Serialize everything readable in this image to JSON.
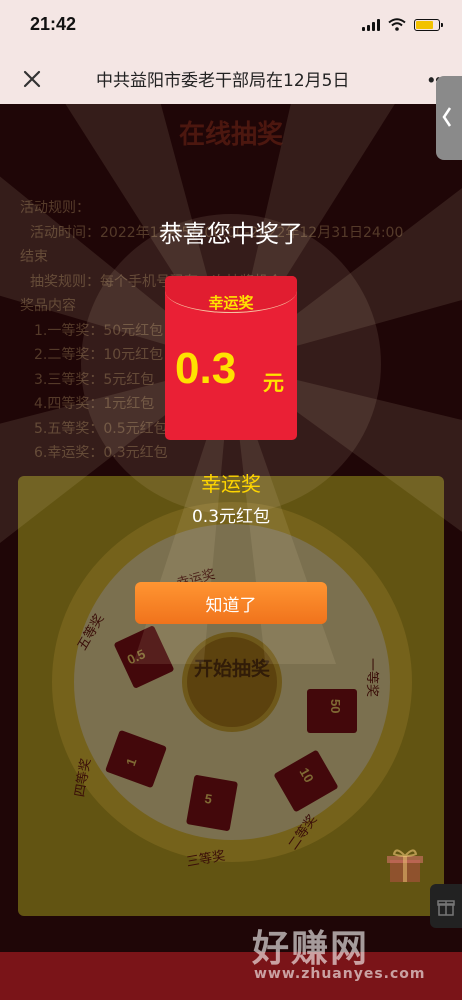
{
  "status_bar": {
    "time": "21:42"
  },
  "nav": {
    "title": "中共益阳市委老干部局在12月5日"
  },
  "page": {
    "title": "在线抽奖",
    "rules": [
      "活动规则：",
      "活动时间：2022年12月5日00:00-2022年12月31日24:00",
      "结束",
      "抽奖规则：每个手机号码有一次抽奖机会",
      "奖品内容",
      "1.一等奖：50元红包",
      "2.二等奖：10元红包",
      "3.三等奖：5元红包",
      "4.四等奖：1元红包",
      "5.五等奖：0.5元红包",
      "6.幸运奖：0.3元红包"
    ],
    "wheel": {
      "center_label": "开始抽奖",
      "prizes": [
        "0.5",
        "50",
        "10",
        "5",
        "1"
      ],
      "labels": [
        "一等奖",
        "二等奖",
        "三等奖",
        "四等奖",
        "五等奖",
        "幸运奖"
      ]
    }
  },
  "modal": {
    "congrats": "恭喜您中奖了",
    "envelope_label": "幸运奖",
    "envelope_amount": "0.3",
    "envelope_unit": "元",
    "prize_name": "幸运奖",
    "prize_desc": "0.3元红包",
    "ok_label": "知道了"
  },
  "watermark": {
    "text": "好赚网",
    "url": "www.zhuanyes.com"
  },
  "colors": {
    "accent_button": "#f58220",
    "envelope": "#ea2035",
    "prize_gold": "#ffd600"
  }
}
